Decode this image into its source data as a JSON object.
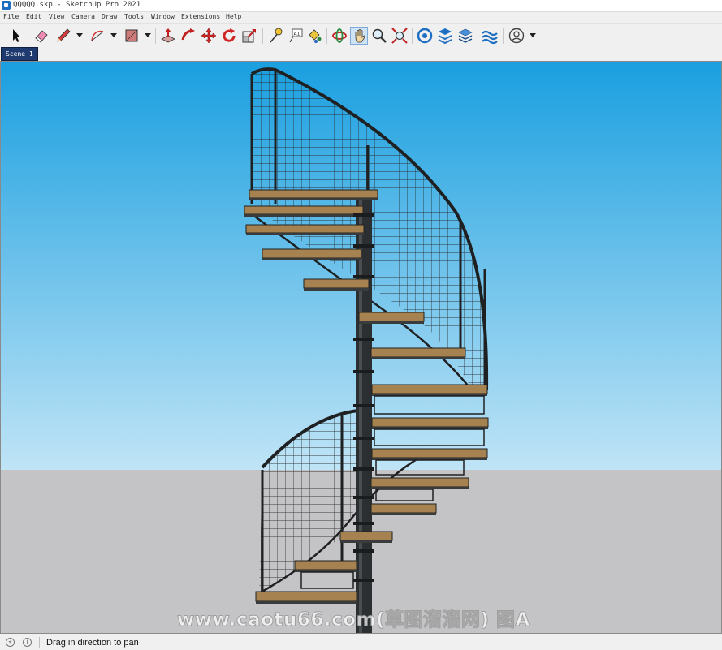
{
  "window": {
    "title": "QQQQQ.skp - SketchUp Pro 2021"
  },
  "menu": [
    "File",
    "Edit",
    "View",
    "Camera",
    "Draw",
    "Tools",
    "Window",
    "Extensions",
    "Help"
  ],
  "toolbar": {
    "tools": [
      "select-icon",
      "eraser-icon",
      "pencil-icon",
      "arc-icon",
      "rectangle-icon",
      "push-pull-icon",
      "follow-me-icon",
      "move-icon",
      "rotate-icon",
      "scale-icon",
      "tape-measure-icon",
      "text-icon",
      "paint-bucket-icon",
      "orbit-icon",
      "pan-icon",
      "zoom-icon",
      "zoom-extents-icon",
      "warehouse-icon",
      "extension-warehouse-icon",
      "layers-icon",
      "sandbox-icon",
      "account-icon"
    ],
    "active_tool": "pan-icon"
  },
  "scenes": [
    "Scene 1"
  ],
  "viewport": {
    "sky_top": "#1a9fe0",
    "sky_bottom": "#bfe4f6",
    "ground": "#c4c4c6"
  },
  "watermark": "www.caotu66.com(草图溜溜网) 图A",
  "status": {
    "hint": "Drag in direction to pan"
  }
}
